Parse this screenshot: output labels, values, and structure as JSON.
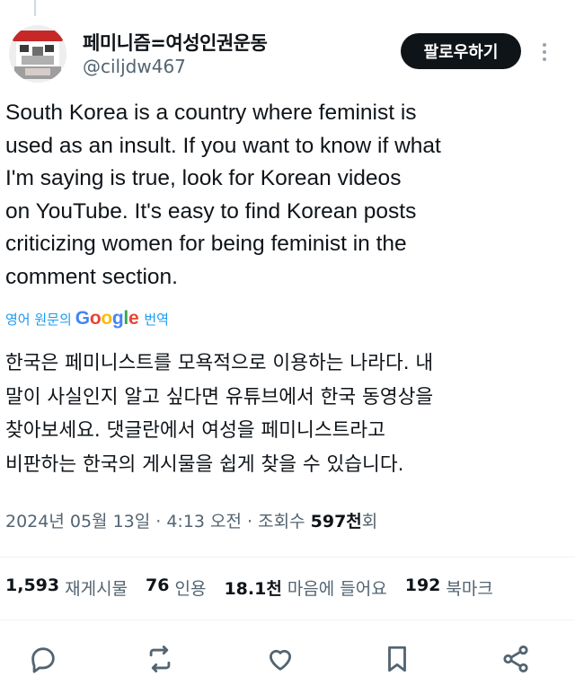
{
  "author": {
    "display_name": "페미니즘=여성인권운동",
    "handle": "@ciljdw467",
    "avatar": "avatar-image"
  },
  "actions": {
    "follow_label": "팔로우하기",
    "more_icon": "more-vertical-icon"
  },
  "tweet": {
    "lines": [
      "South Korea is a country where feminist is",
      "used as an insult. If you want to know if what",
      "I'm saying is true, look for Korean videos",
      "on YouTube. It's easy to find Korean posts",
      "criticizing women for being feminist in the",
      "comment section."
    ]
  },
  "translation": {
    "prefix": "영어 원문의",
    "provider": "Google",
    "suffix": "번역",
    "lines": [
      "한국은 페미니스트를 모욕적으로 이용하는 나라다. 내",
      "말이 사실인지 알고 싶다면 유튜브에서 한국 동영상을",
      "찾아보세요. 댓글란에서 여성을 페미니스트라고",
      "비판하는 한국의 게시물을 쉽게 찾을 수 있습니다."
    ]
  },
  "meta": {
    "timestamp": "2024년 05월 13일 · 4:13 오전 · 조회수 ",
    "views_value": "597천",
    "views_suffix": "회"
  },
  "stats": {
    "reposts_value": "1,593",
    "reposts_label": "재게시물",
    "quotes_value": "76",
    "quotes_label": "인용",
    "likes_value": "18.1천",
    "likes_label": "마음에 들어요",
    "bookmarks_value": "192",
    "bookmarks_label": "북마크"
  },
  "action_bar": {
    "reply_icon": "reply-icon",
    "repost_icon": "repost-icon",
    "like_icon": "heart-icon",
    "bookmark_icon": "bookmark-icon",
    "share_icon": "share-icon"
  },
  "colors": {
    "link_blue": "#1d9bf0",
    "text_primary": "#0f1419",
    "text_secondary": "#536471",
    "button_dark": "#0f1419"
  }
}
